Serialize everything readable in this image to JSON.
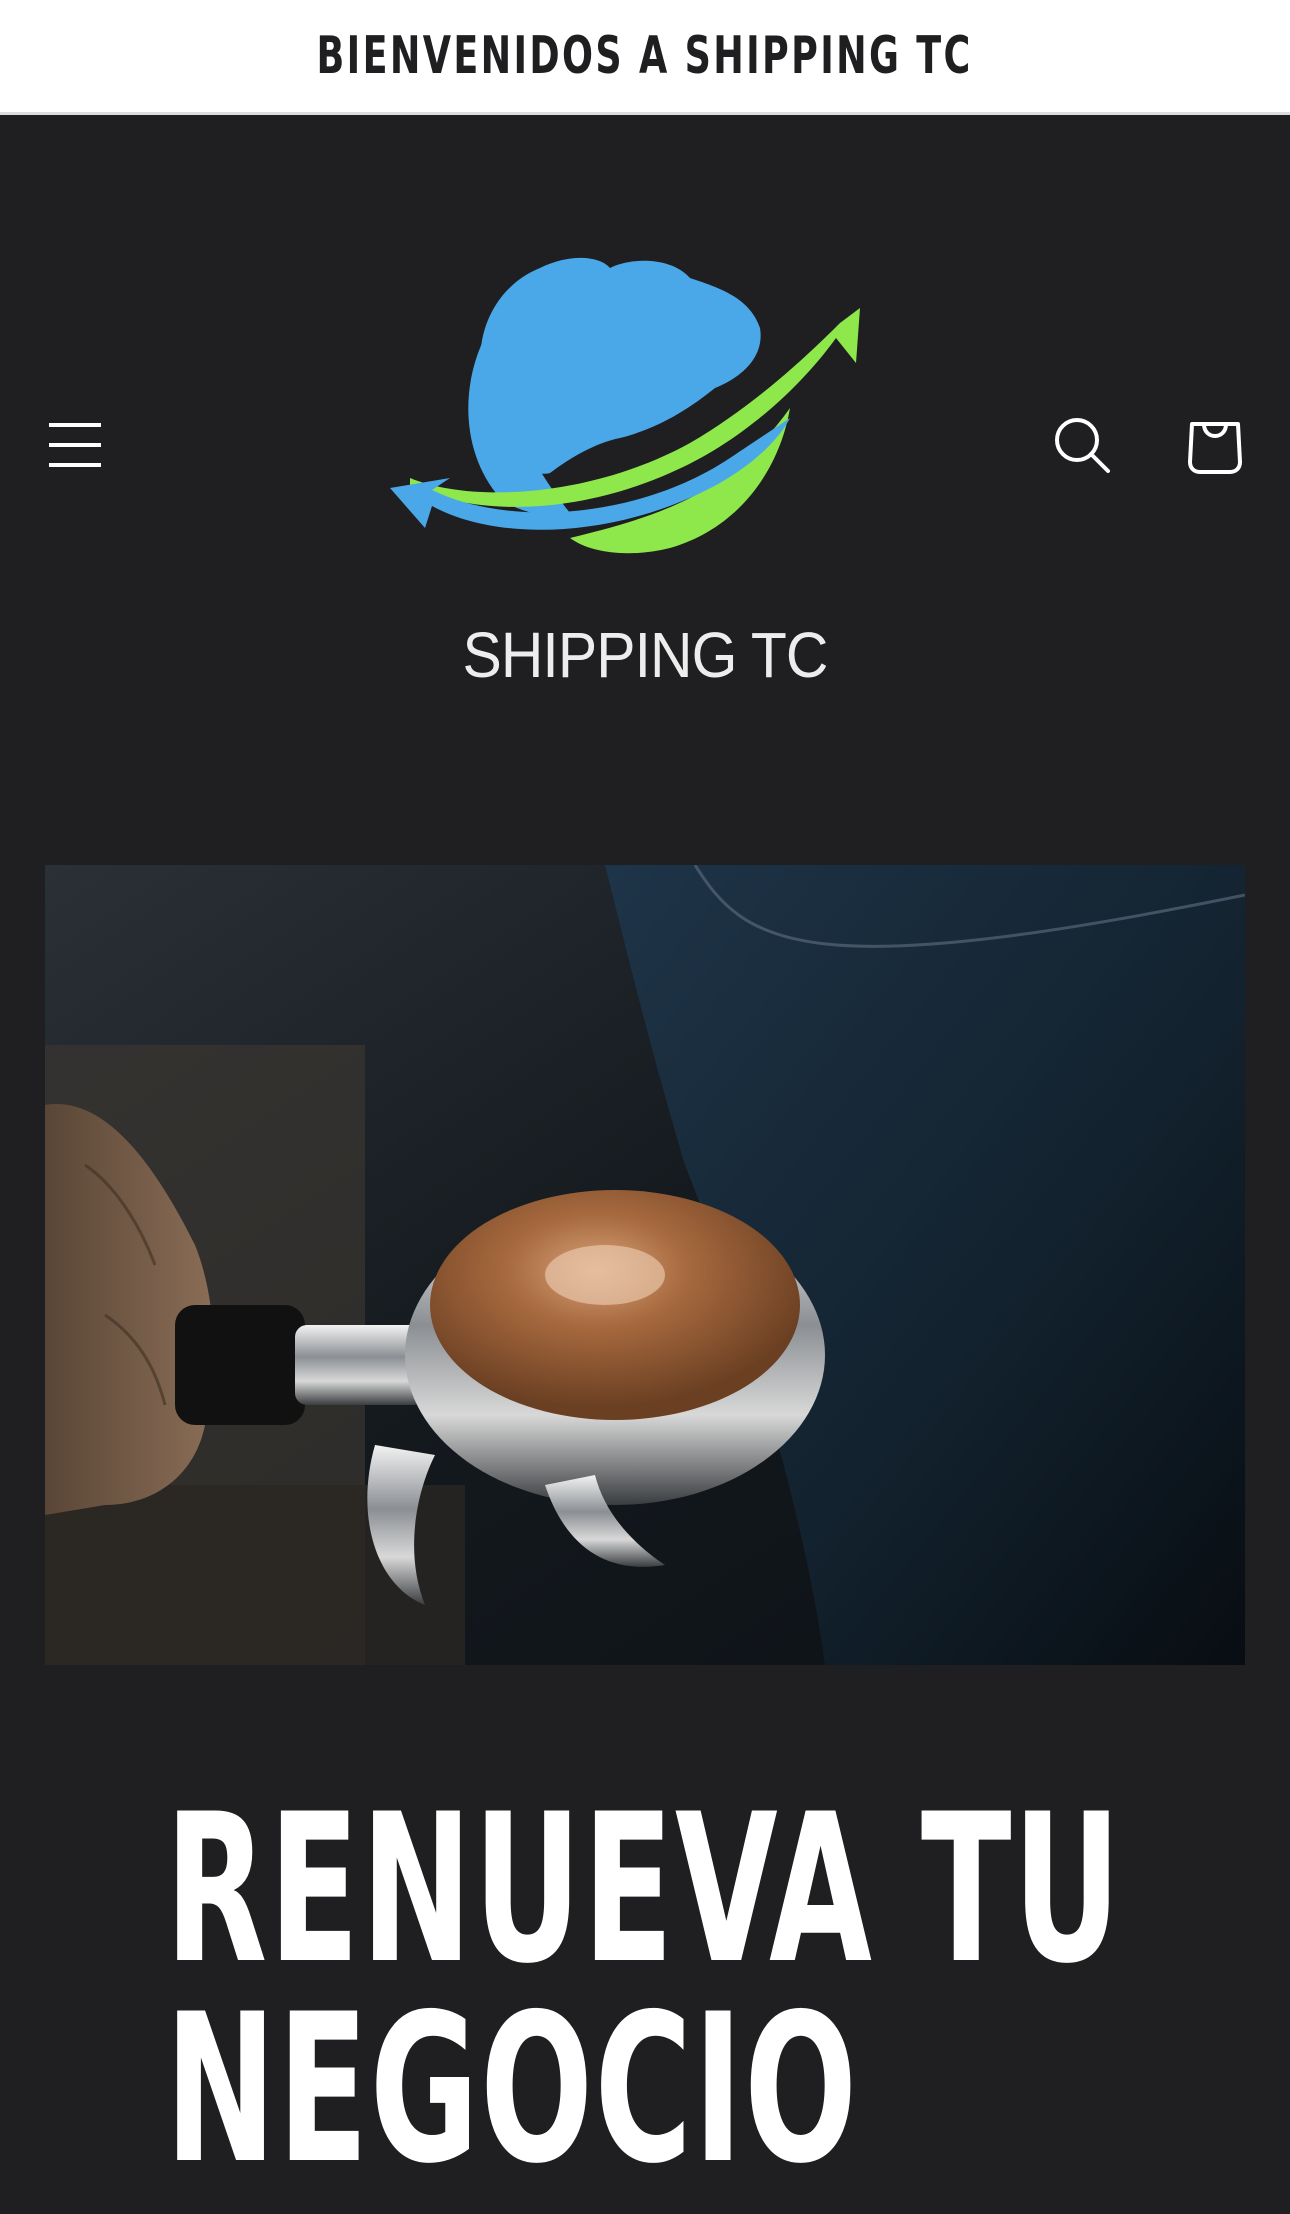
{
  "announcement": {
    "text": "BIENVENIDOS A SHIPPING TC"
  },
  "header": {
    "menu_icon": "hamburger-menu-icon",
    "search_icon": "search-icon",
    "cart_icon": "shopping-bag-icon",
    "logo": {
      "text": "SHIPPING TC",
      "colors": {
        "globe": "#4ba8e8",
        "swoosh": "#8fe84b"
      }
    }
  },
  "hero": {
    "image_description_icon": "espresso-portafilter-image",
    "heading_line_1": "RENUEVA TU",
    "heading_line_2": "NEGOCIO"
  },
  "theme": {
    "background": "#1f1f21",
    "announcement_background": "#ffffff",
    "text": "#ffffff"
  }
}
